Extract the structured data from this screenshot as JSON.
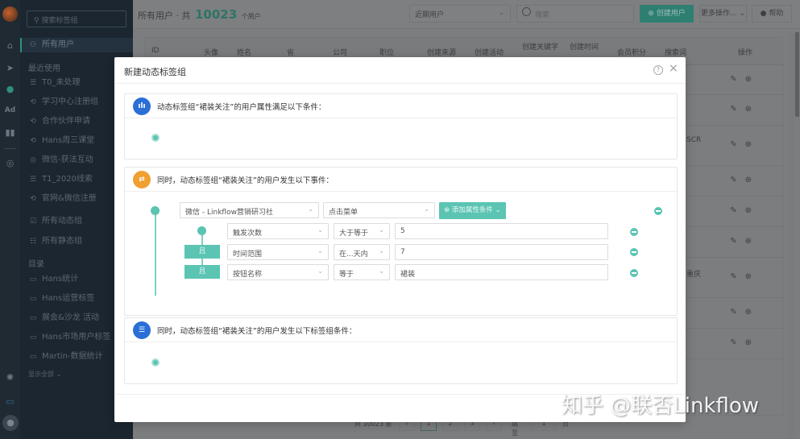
{
  "sidebar": {
    "search_placeholder": "搜索标签组",
    "current_item": "所有用户",
    "recent_header": "最近使用",
    "recent_items": [
      {
        "label": "T0_未处理",
        "icon": "list-icon"
      },
      {
        "label": "学习中心注册组",
        "icon": "sync-icon"
      },
      {
        "label": "合作伙伴申请",
        "icon": "sync-icon"
      },
      {
        "label": "Hans周三课堂",
        "icon": "sync-icon"
      },
      {
        "label": "微信-获法互动",
        "icon": "wechat-icon"
      },
      {
        "label": "T1_2020线索",
        "icon": "list-icon"
      },
      {
        "label": "官网&微信注册",
        "icon": "sync-icon"
      }
    ],
    "group_items": [
      {
        "label": "所有动态组",
        "icon": "dynamic-group-icon"
      },
      {
        "label": "所有静态组",
        "icon": "static-group-icon"
      }
    ],
    "catalog_header": "目录",
    "catalog_items": [
      {
        "label": "Hans统计",
        "icon": "folder-icon"
      },
      {
        "label": "Hans运营标签",
        "icon": "folder-icon"
      },
      {
        "label": "展会&沙龙 活动",
        "icon": "folder-icon"
      },
      {
        "label": "Hans市场用户标签",
        "icon": "folder-icon"
      },
      {
        "label": "Martin-数据统计",
        "icon": "folder-icon"
      }
    ],
    "show_all": "显示全部 ⌄"
  },
  "rail": {
    "items": [
      "home-icon",
      "send-icon",
      "user-icon",
      "ad-icon",
      "chart-icon",
      "wechat-icon"
    ],
    "ad_label": "Ad",
    "bottom": [
      "gear-icon",
      "chat-icon",
      "avatar-icon"
    ]
  },
  "topbar": {
    "title_prefix": "所有用户 · 共",
    "count": "10023",
    "title_suffix": "个用户",
    "filter_select": "近期用户",
    "search_placeholder": "搜索",
    "create_button": "⊕ 创建用户",
    "more_button": "更多操作... ⌄",
    "help_button": "帮助"
  },
  "table": {
    "columns": [
      "ID",
      "头像",
      "姓名",
      "省",
      "公司",
      "职位",
      "创建来源",
      "创建活动",
      "创建关键字",
      "创建时间",
      "会员积分",
      "搜索词",
      "操作"
    ],
    "partial_cells": [
      "SCR",
      "重庆"
    ],
    "row_count": 9
  },
  "pager": {
    "total": "共 10023 条",
    "prev": "‹",
    "pages": [
      "1",
      "2",
      "3"
    ],
    "next": "›",
    "jump_label": "跳至",
    "jump_value": "1",
    "page_unit": "页"
  },
  "modal": {
    "title": "新建动态标签组",
    "help": "?",
    "close": "×",
    "section1": {
      "title": "动态标签组“裙装关注”的用户属性满足以下条件：",
      "badge_color": "#2b6fd6",
      "badge_label": "ılı"
    },
    "section2": {
      "title": "同时，动态标签组“裙装关注”的用户发生以下事件：",
      "badge_color": "#f0a030",
      "badge_label": "⇄",
      "event_source": "微信 - Linkflow营销研习社",
      "event_type": "点击菜单",
      "add_property_button": "⊕ 添加属性条件 ⌄",
      "conditions": [
        {
          "connector": "",
          "field": "触发次数",
          "operator": "大于等于",
          "value": "5"
        },
        {
          "connector": "且",
          "field": "时间范围",
          "operator": "在...天内",
          "value": "7"
        },
        {
          "connector": "且",
          "field": "按钮名称",
          "operator": "等于",
          "value": "裙装"
        }
      ]
    },
    "section3": {
      "title": "同时，动态标签组“裙装关注”的用户发生以下标签组条件：",
      "badge_color": "#2b6fd6",
      "badge_label": "☰"
    }
  },
  "colors": {
    "accent": "#5bc4b3",
    "sidebar_bg": "#1c2630",
    "blue_badge": "#2b6fd6",
    "orange_badge": "#f0a030"
  },
  "watermark": "知乎 @联否Linkflow"
}
